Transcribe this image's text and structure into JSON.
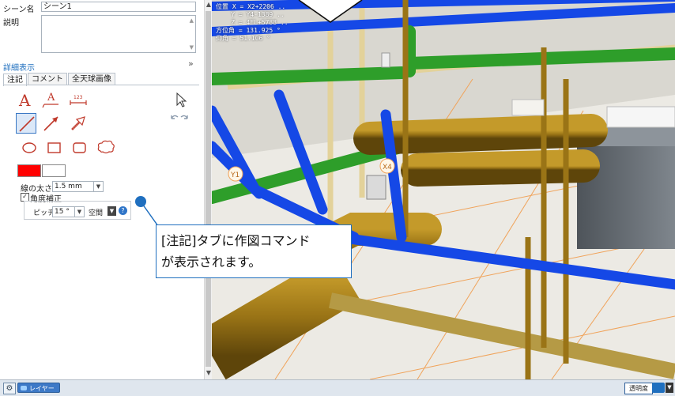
{
  "scene": {
    "name_label": "シーン名",
    "name_value": "シーン1",
    "desc_label": "説明",
    "detail_link": "詳細表示"
  },
  "tabs": [
    {
      "label": "注記",
      "active": true
    },
    {
      "label": "コメント",
      "active": false
    },
    {
      "label": "全天球画像",
      "active": false
    }
  ],
  "tools": {
    "row1": [
      "text-tool-icon",
      "leader-text-tool-icon",
      "dimension-tool-icon",
      "pointer-icon"
    ],
    "row2": [
      "line-tool-icon",
      "arrow-tool-icon",
      "hollow-arrow-tool-icon",
      "undo-redo-icon"
    ],
    "row3": [
      "ellipse-tool-icon",
      "rectangle-tool-icon",
      "rounded-rect-tool-icon",
      "cloud-tool-icon"
    ]
  },
  "style": {
    "line_color": "#ff0000",
    "fill_color": "#ffffff",
    "line_width_label": "線の太さ",
    "line_width_value": "1.5 mm",
    "angle_snap_label": "角度補正",
    "angle_snap_checked": true,
    "pitch_label": "ピッチ",
    "pitch_value": "15 °",
    "space_label": "空間"
  },
  "viewport": {
    "hud_lines": [
      "位置 X = X2+2206 ..",
      "    Y = Y4-1389 ..",
      "    Z = 4FL+5788 ..",
      "方位角 = 131.925 °",
      "仰角 = 51.106 °"
    ],
    "grid_labels": [
      "Y1",
      "X4"
    ]
  },
  "callout": {
    "line1": "[注記]タブに作図コマンド",
    "line2": "が表示されます。",
    "accent_color": "#1f6fbf"
  },
  "statusbar": {
    "layer_button": "レイヤー",
    "transparency_label": "透明度"
  },
  "colors": {
    "pipe_blue": "#1548e6",
    "pipe_green": "#2e9e2a",
    "pipe_brown": "#9a7416",
    "duct_gray": "#6b7178"
  }
}
